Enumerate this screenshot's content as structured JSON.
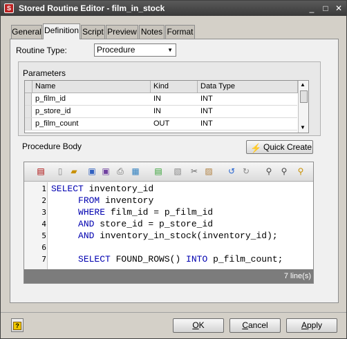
{
  "window": {
    "title": "Stored Routine Editor - film_in_stock",
    "app_icon": "sql-file-icon"
  },
  "tabs": [
    {
      "label": "General"
    },
    {
      "label": "Definition",
      "active": true
    },
    {
      "label": "Script"
    },
    {
      "label": "Preview"
    },
    {
      "label": "Notes"
    },
    {
      "label": "Format"
    }
  ],
  "routine_type": {
    "label": "Routine Type:",
    "value": "Procedure"
  },
  "parameters": {
    "label": "Parameters",
    "columns": [
      "Name",
      "Kind",
      "Data Type"
    ],
    "rows": [
      [
        "p_film_id",
        "IN",
        "INT"
      ],
      [
        "p_store_id",
        "IN",
        "INT"
      ],
      [
        "p_film_count",
        "OUT",
        "INT"
      ]
    ]
  },
  "body": {
    "label": "Procedure Body",
    "quick_create": "Quick Create",
    "status": "7 line(s)",
    "line_numbers": [
      "1",
      "2",
      "3",
      "4",
      "5",
      "6",
      "7"
    ],
    "lines": [
      [
        {
          "t": "SELECT",
          "kw": true
        },
        {
          "t": " inventory_id"
        }
      ],
      [
        {
          "t": "     "
        },
        {
          "t": "FROM",
          "kw": true
        },
        {
          "t": " inventory"
        }
      ],
      [
        {
          "t": "     "
        },
        {
          "t": "WHERE",
          "kw": true
        },
        {
          "t": " film_id = p_film_id"
        }
      ],
      [
        {
          "t": "     "
        },
        {
          "t": "AND",
          "kw": true
        },
        {
          "t": " store_id = p_store_id"
        }
      ],
      [
        {
          "t": "     "
        },
        {
          "t": "AND",
          "kw": true
        },
        {
          "t": " inventory_in_stock(inventory_id);"
        }
      ],
      [
        {
          "t": ""
        }
      ],
      [
        {
          "t": "     "
        },
        {
          "t": "SELECT",
          "kw": true
        },
        {
          "t": " FOUND_ROWS() "
        },
        {
          "t": "INTO",
          "kw": true
        },
        {
          "t": " p_film_count;"
        }
      ]
    ],
    "toolbar_icons": [
      "sql-icon",
      "new-icon",
      "open-icon",
      "save-icon",
      "save-as-icon",
      "print-icon",
      "print-preview-icon",
      "copy-document-icon",
      "paste-special-icon",
      "cut-icon",
      "paste-icon",
      "undo-icon",
      "redo-icon",
      "find-icon",
      "replace-icon",
      "find-next-icon"
    ]
  },
  "buttons": {
    "ok": "OK",
    "ok_rest": "K",
    "ok_key": "O",
    "cancel_key": "C",
    "cancel_rest": "ancel",
    "apply_key": "A",
    "apply_rest": "pply"
  }
}
